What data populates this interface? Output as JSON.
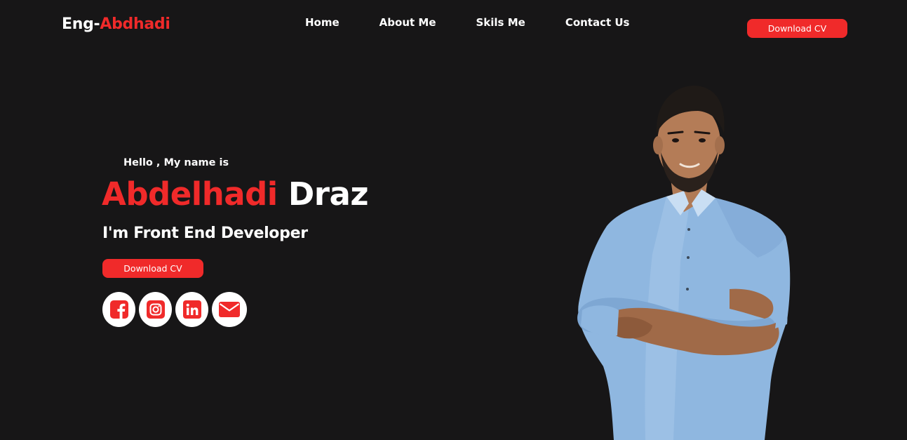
{
  "header": {
    "logo_prefix": "Eng-",
    "logo_accent": "Abdhadi",
    "nav": [
      {
        "label": "Home"
      },
      {
        "label": "About Me"
      },
      {
        "label": "Skils Me"
      },
      {
        "label": "Contact Us"
      }
    ],
    "cta_label": "Download CV"
  },
  "hero": {
    "greeting": "Hello , My name is",
    "first_name": "Abdelhadi",
    "last_name": "Draz",
    "role": "I'm Front End Developer",
    "cta_label": "Download CV",
    "socials": [
      {
        "icon": "facebook-icon"
      },
      {
        "icon": "instagram-icon"
      },
      {
        "icon": "linkedin-icon"
      },
      {
        "icon": "envelope-icon"
      }
    ],
    "portrait": "person-photo"
  },
  "colors": {
    "background": "#171617",
    "accent": "#f02a2a",
    "text": "#ffffff"
  }
}
